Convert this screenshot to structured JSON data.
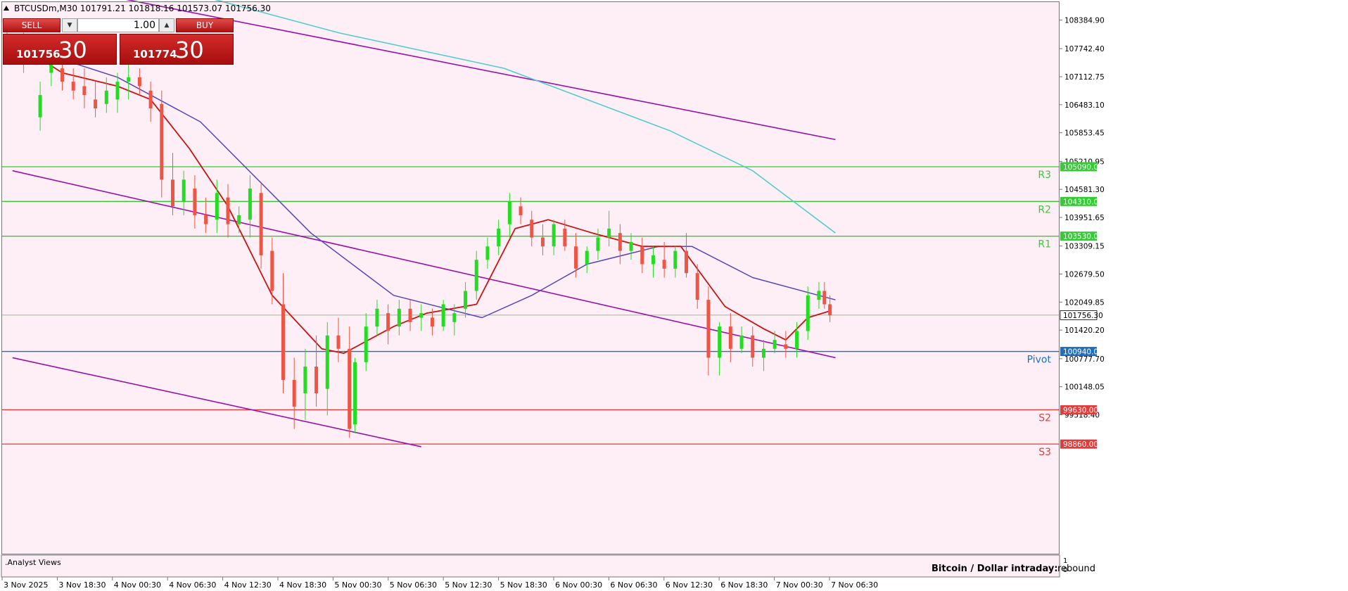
{
  "header": {
    "symbol_line": "BTCUSDm,M30  101791.21 101818.16 101573.07 101756.30"
  },
  "trade_panel": {
    "sell_label": "SELL",
    "buy_label": "BUY",
    "lot_value": "1.00",
    "sell_price_small": "101756",
    "sell_price_big": "30",
    "buy_price_small": "101774",
    "buy_price_big": "30"
  },
  "indicator_label": ".Analyst Views",
  "indicator_panel": {
    "scale_top": "1",
    "scale_bottom": "0"
  },
  "annotation": {
    "title": "Bitcoin / Dollar intraday:",
    "value": "rebound"
  },
  "colors": {
    "background": "#fdeff5",
    "bull": "#22dd22",
    "bear": "#ee5544",
    "resistance": "#33cc33",
    "support": "#e03c3c",
    "pivot": "#1f6fbf",
    "sma_fast": "#cc1111",
    "sma_mid": "#5544bb",
    "sma_slow": "#55cccc",
    "channel": "#9911aa"
  },
  "chart_data": {
    "type": "candlestick",
    "symbol": "BTCUSDm",
    "timeframe": "M30",
    "ylim": [
      99000,
      109000
    ],
    "price_ticks": [
      "108384.90",
      "107742.40",
      "107112.75",
      "106483.10",
      "105853.45",
      "105210.95",
      "104581.30",
      "103951.65",
      "103309.15",
      "102679.50",
      "102049.85",
      "101420.20",
      "100777.70",
      "100148.05",
      "99518.40"
    ],
    "time_labels": [
      "3 Nov 2025",
      "3 Nov 18:30",
      "4 Nov 00:30",
      "4 Nov 06:30",
      "4 Nov 12:30",
      "4 Nov 18:30",
      "5 Nov 00:30",
      "5 Nov 06:30",
      "5 Nov 12:30",
      "5 Nov 18:30",
      "6 Nov 00:30",
      "6 Nov 06:30",
      "6 Nov 12:30",
      "6 Nov 18:30",
      "7 Nov 00:30",
      "7 Nov 06:30"
    ],
    "current_price": "101756.30",
    "levels": [
      {
        "name": "R3",
        "value": 105090.0,
        "label": "105090.00",
        "kind": "resistance"
      },
      {
        "name": "R2",
        "value": 104310.0,
        "label": "104310.00",
        "kind": "resistance"
      },
      {
        "name": "R1",
        "value": 103530.0,
        "label": "103530.00",
        "kind": "resistance"
      },
      {
        "name": "Pivot",
        "value": 100940.0,
        "label": "100940.00",
        "kind": "pivot"
      },
      {
        "name": "S2",
        "value": 99630.0,
        "label": "99630.00",
        "kind": "support"
      },
      {
        "name": "S3",
        "value": 98860.0,
        "label": "98860.00",
        "kind": "support"
      }
    ],
    "channel": {
      "upper": [
        [
          -1,
          109400
        ],
        [
          150,
          105700
        ]
      ],
      "middle": [
        [
          1,
          105000
        ],
        [
          150,
          100800
        ]
      ],
      "lower": [
        [
          1,
          100800
        ],
        [
          75,
          98800
        ]
      ]
    },
    "sma_slow": [
      [
        0,
        109800
      ],
      [
        30,
        109100
      ],
      [
        60,
        108100
      ],
      [
        90,
        107300
      ],
      [
        120,
        105900
      ],
      [
        135,
        105000
      ],
      [
        150,
        103600
      ]
    ],
    "sma_mid": [
      [
        0,
        107900
      ],
      [
        20,
        107100
      ],
      [
        35,
        106100
      ],
      [
        55,
        103600
      ],
      [
        70,
        102200
      ],
      [
        86,
        101700
      ],
      [
        95,
        102200
      ],
      [
        105,
        102900
      ],
      [
        118,
        103300
      ],
      [
        124,
        103300
      ],
      [
        135,
        102600
      ],
      [
        150,
        102100
      ]
    ],
    "sma_fast": [
      [
        0,
        108000
      ],
      [
        10,
        107200
      ],
      [
        20,
        106900
      ],
      [
        26,
        106600
      ],
      [
        33,
        105500
      ],
      [
        40,
        104200
      ],
      [
        48,
        102200
      ],
      [
        57,
        101000
      ],
      [
        61,
        100900
      ],
      [
        70,
        101500
      ],
      [
        76,
        101800
      ],
      [
        85,
        102000
      ],
      [
        92,
        103700
      ],
      [
        98,
        103900
      ],
      [
        106,
        103600
      ],
      [
        115,
        103300
      ],
      [
        122,
        103300
      ],
      [
        130,
        101950
      ],
      [
        137,
        101450
      ],
      [
        141,
        101200
      ],
      [
        145,
        101700
      ],
      [
        149,
        101850
      ]
    ],
    "candles": [
      [
        0,
        108000,
        108200,
        107500,
        107700
      ],
      [
        3,
        107700,
        108100,
        107200,
        107950
      ],
      [
        6,
        106200,
        107000,
        105900,
        106700
      ],
      [
        8,
        107200,
        107800,
        106900,
        107500
      ],
      [
        10,
        107300,
        107500,
        106800,
        107000
      ],
      [
        12,
        107000,
        107300,
        106600,
        106800
      ],
      [
        14,
        106900,
        107300,
        106400,
        106700
      ],
      [
        16,
        106600,
        107000,
        106200,
        106400
      ],
      [
        18,
        106500,
        107100,
        106300,
        106800
      ],
      [
        20,
        106600,
        107200,
        106300,
        107000
      ],
      [
        22,
        107000,
        107400,
        106600,
        107100
      ],
      [
        24,
        107100,
        107300,
        106700,
        106900
      ],
      [
        26,
        106800,
        107000,
        106100,
        106400
      ],
      [
        28,
        106500,
        106800,
        104400,
        104800
      ],
      [
        30,
        104800,
        105400,
        104000,
        104200
      ],
      [
        32,
        104300,
        105000,
        104000,
        104800
      ],
      [
        34,
        104600,
        104900,
        103700,
        104000
      ],
      [
        36,
        104000,
        104400,
        103600,
        103800
      ],
      [
        38,
        103900,
        104800,
        103600,
        104500
      ],
      [
        40,
        104400,
        104700,
        103500,
        103800
      ],
      [
        42,
        103800,
        104200,
        103600,
        104000
      ],
      [
        44,
        103900,
        104900,
        103500,
        104600
      ],
      [
        46,
        104500,
        104700,
        102800,
        103100
      ],
      [
        48,
        103200,
        103500,
        102000,
        102300
      ],
      [
        50,
        102000,
        102700,
        100000,
        100300
      ],
      [
        52,
        100300,
        100800,
        99200,
        99700
      ],
      [
        54,
        100000,
        101000,
        99400,
        100600
      ],
      [
        56,
        100600,
        101300,
        99700,
        100000
      ],
      [
        58,
        100100,
        101600,
        99500,
        101300
      ],
      [
        60,
        101300,
        101700,
        100700,
        101000
      ],
      [
        62,
        101000,
        101500,
        99000,
        99200
      ],
      [
        63,
        99300,
        100800,
        99100,
        100700
      ],
      [
        65,
        100700,
        101800,
        100500,
        101500
      ],
      [
        67,
        101500,
        102100,
        101300,
        101900
      ],
      [
        69,
        101800,
        102000,
        101100,
        101400
      ],
      [
        71,
        101500,
        102100,
        101300,
        101900
      ],
      [
        73,
        101900,
        102100,
        101400,
        101600
      ],
      [
        75,
        101700,
        102000,
        101400,
        101800
      ],
      [
        77,
        101700,
        101900,
        101300,
        101500
      ],
      [
        79,
        101500,
        102100,
        101400,
        102000
      ],
      [
        81,
        101600,
        102000,
        101300,
        101800
      ],
      [
        83,
        101900,
        102500,
        101700,
        102300
      ],
      [
        85,
        102300,
        103200,
        102100,
        103000
      ],
      [
        87,
        103000,
        103500,
        102800,
        103300
      ],
      [
        89,
        103300,
        103900,
        103100,
        103700
      ],
      [
        91,
        103800,
        104500,
        103500,
        104300
      ],
      [
        93,
        104200,
        104400,
        103800,
        104000
      ],
      [
        95,
        103900,
        104100,
        103300,
        103500
      ],
      [
        97,
        103500,
        103800,
        103100,
        103300
      ],
      [
        99,
        103300,
        103900,
        103100,
        103800
      ],
      [
        101,
        103700,
        103900,
        103200,
        103300
      ],
      [
        103,
        103300,
        103600,
        102600,
        102800
      ],
      [
        105,
        102900,
        103300,
        102700,
        103200
      ],
      [
        107,
        103200,
        103700,
        103000,
        103500
      ],
      [
        109,
        103500,
        104100,
        103300,
        103700
      ],
      [
        111,
        103600,
        103800,
        102900,
        103200
      ],
      [
        113,
        103200,
        103600,
        103000,
        103400
      ],
      [
        115,
        103300,
        103500,
        102700,
        102900
      ],
      [
        117,
        102900,
        103300,
        102600,
        103100
      ],
      [
        119,
        103000,
        103400,
        102600,
        102800
      ],
      [
        121,
        102800,
        103300,
        102600,
        103200
      ],
      [
        123,
        103200,
        103600,
        102600,
        102700
      ],
      [
        125,
        102700,
        102900,
        101900,
        102100
      ],
      [
        127,
        102100,
        102400,
        100400,
        100800
      ],
      [
        129,
        100800,
        101600,
        100400,
        101500
      ],
      [
        131,
        101500,
        101800,
        100700,
        101000
      ],
      [
        133,
        101000,
        101500,
        100900,
        101300
      ],
      [
        135,
        101300,
        101500,
        100600,
        100800
      ],
      [
        137,
        100800,
        101200,
        100500,
        101000
      ],
      [
        139,
        101000,
        101400,
        100900,
        101200
      ],
      [
        141,
        101100,
        101400,
        100800,
        101000
      ],
      [
        143,
        101000,
        101600,
        100800,
        101400
      ],
      [
        145,
        101400,
        102400,
        101200,
        102200
      ],
      [
        147,
        102100,
        102500,
        101900,
        102300
      ],
      [
        148,
        102300,
        102500,
        101900,
        102000
      ],
      [
        149,
        102000,
        102200,
        101600,
        101750
      ]
    ]
  }
}
